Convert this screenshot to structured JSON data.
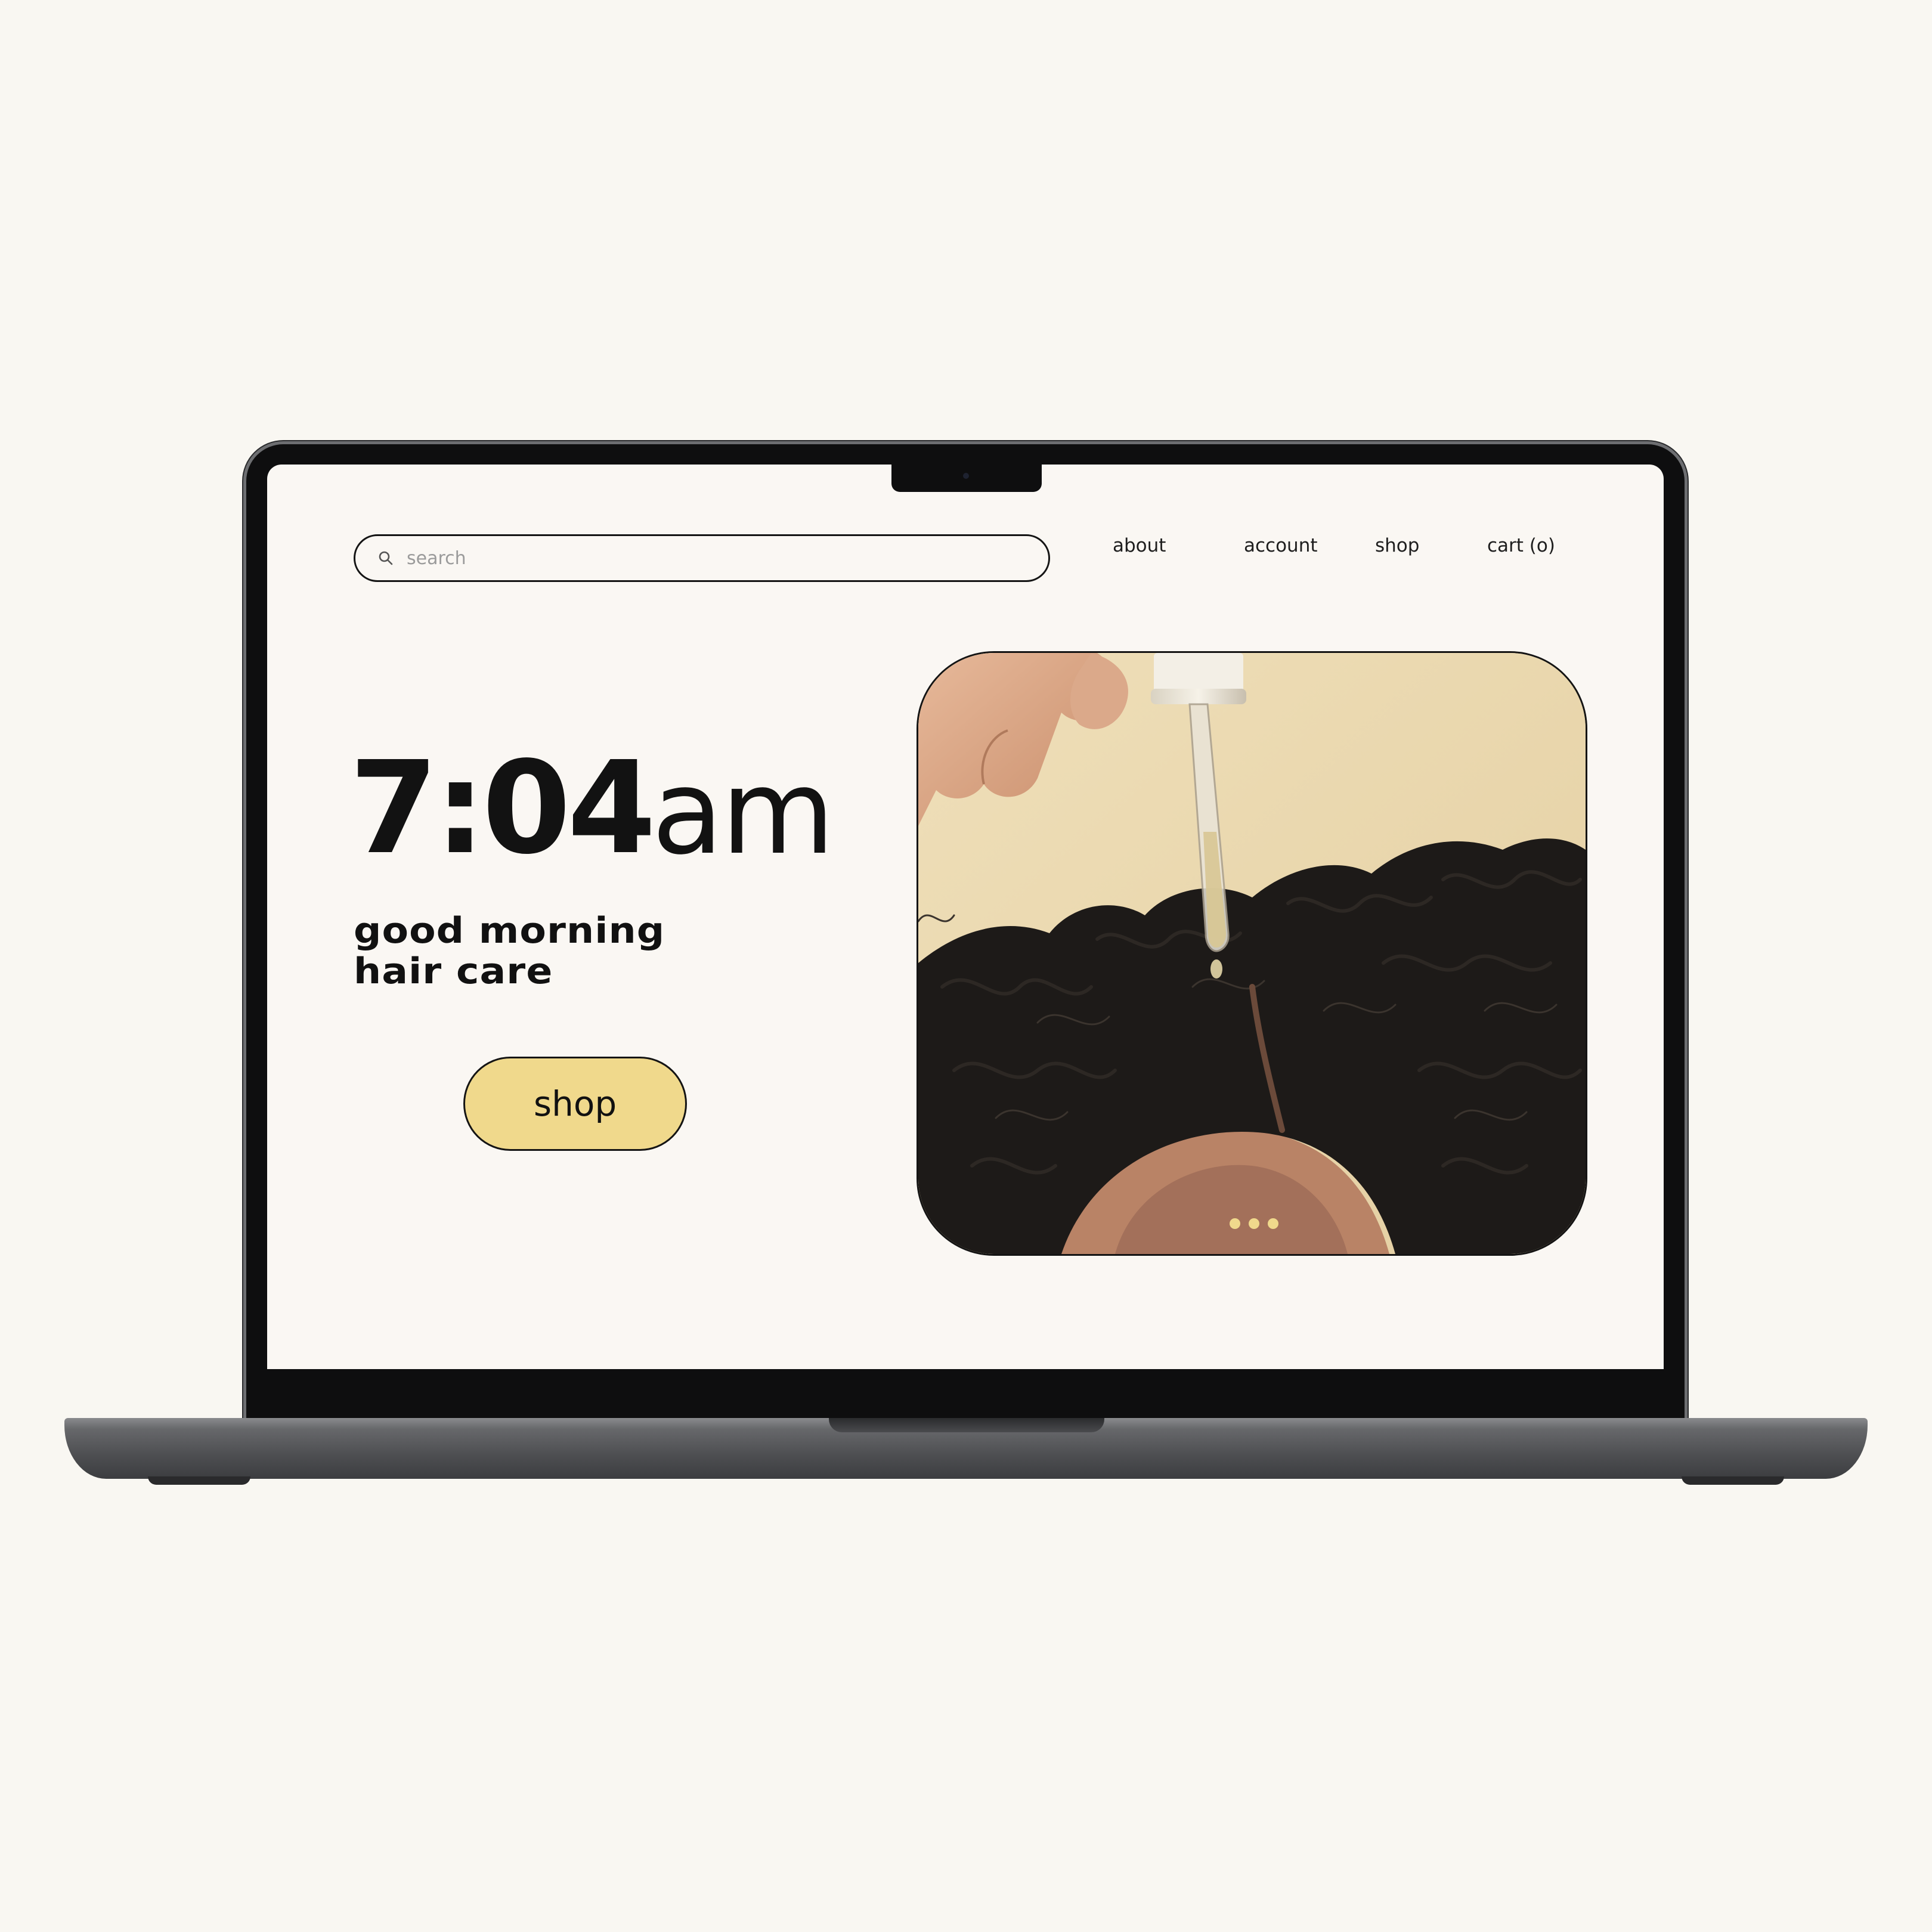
{
  "search": {
    "placeholder": "search"
  },
  "nav": {
    "items": [
      {
        "label": "about"
      },
      {
        "label": "account"
      },
      {
        "label": "shop"
      },
      {
        "label": "cart (o)"
      }
    ]
  },
  "hero": {
    "time": "7:04",
    "time_suffix": "am",
    "tagline_line1": "good morning",
    "tagline_line2": "hair care",
    "cta_label": "shop",
    "carousel": {
      "slide_count": 3
    }
  },
  "colors": {
    "background": "#f9f7f2",
    "screen": "#faf7f3",
    "accent": "#f0d98c",
    "text": "#121212"
  },
  "icons": {
    "search": "search-icon"
  }
}
